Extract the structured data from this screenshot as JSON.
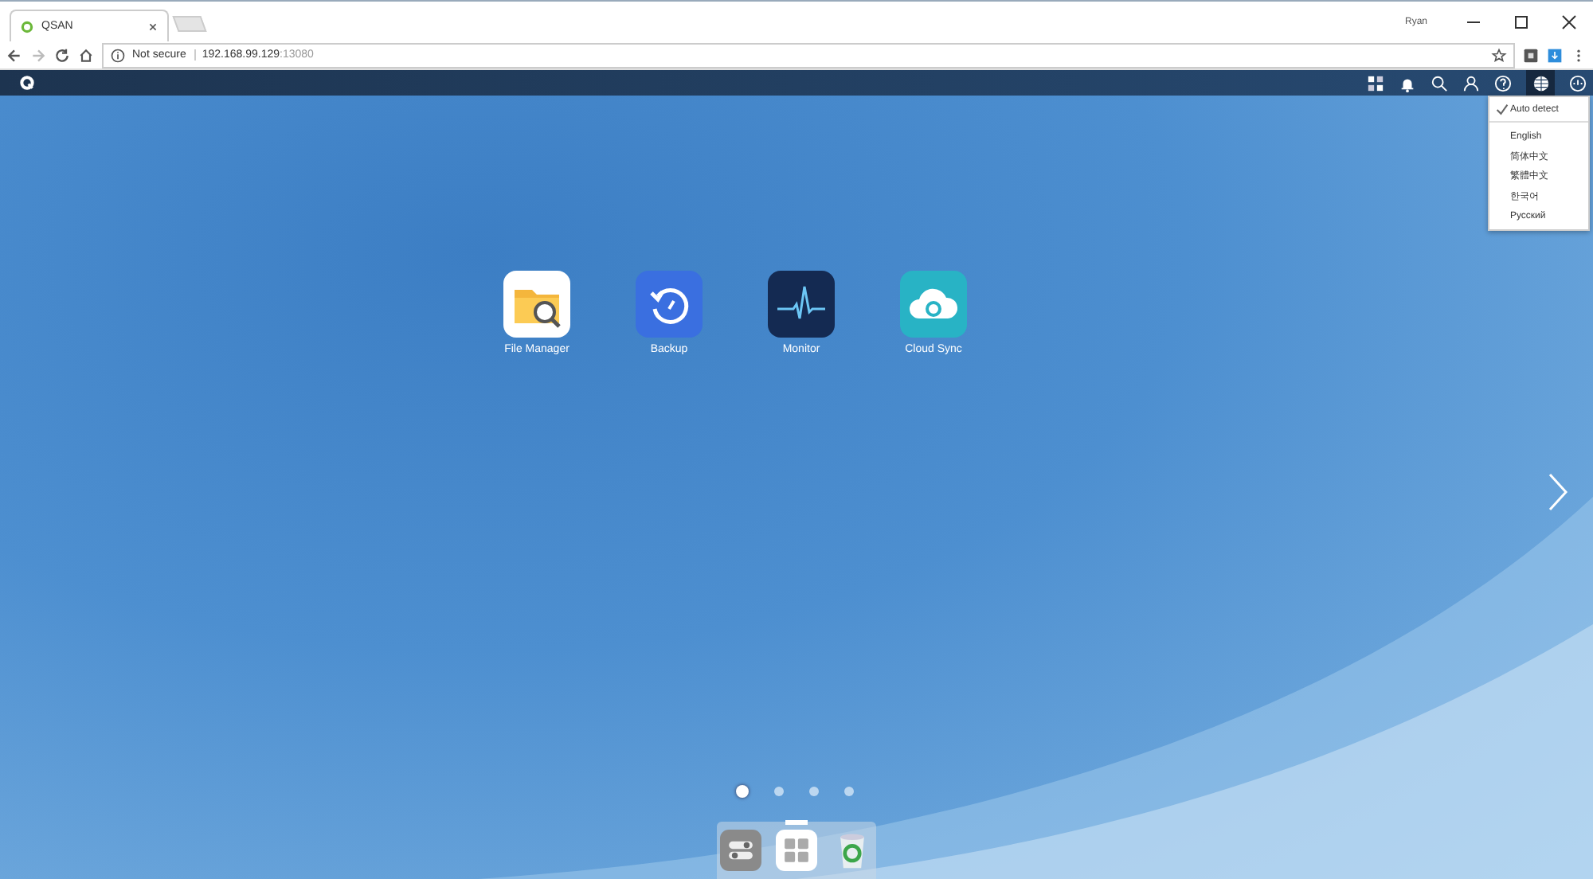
{
  "browser": {
    "tab_title": "QSAN",
    "profile": "Ryan",
    "security": "Not secure",
    "url_host": "192.168.99.129",
    "url_port": ":13080"
  },
  "languages": [
    {
      "label": "Auto detect",
      "selected": true
    },
    {
      "label": "English",
      "selected": false
    },
    {
      "label": "简体中文",
      "selected": false
    },
    {
      "label": "繁體中文",
      "selected": false
    },
    {
      "label": "한국어",
      "selected": false
    },
    {
      "label": "Русский",
      "selected": false
    }
  ],
  "apps": [
    {
      "label": "File Manager",
      "kind": "files"
    },
    {
      "label": "Backup",
      "kind": "backup"
    },
    {
      "label": "Monitor",
      "kind": "monitor"
    },
    {
      "label": "Cloud Sync",
      "kind": "cloud"
    }
  ],
  "pages": [
    {
      "selected": true
    },
    {
      "selected": false
    },
    {
      "selected": false
    },
    {
      "selected": false
    }
  ]
}
